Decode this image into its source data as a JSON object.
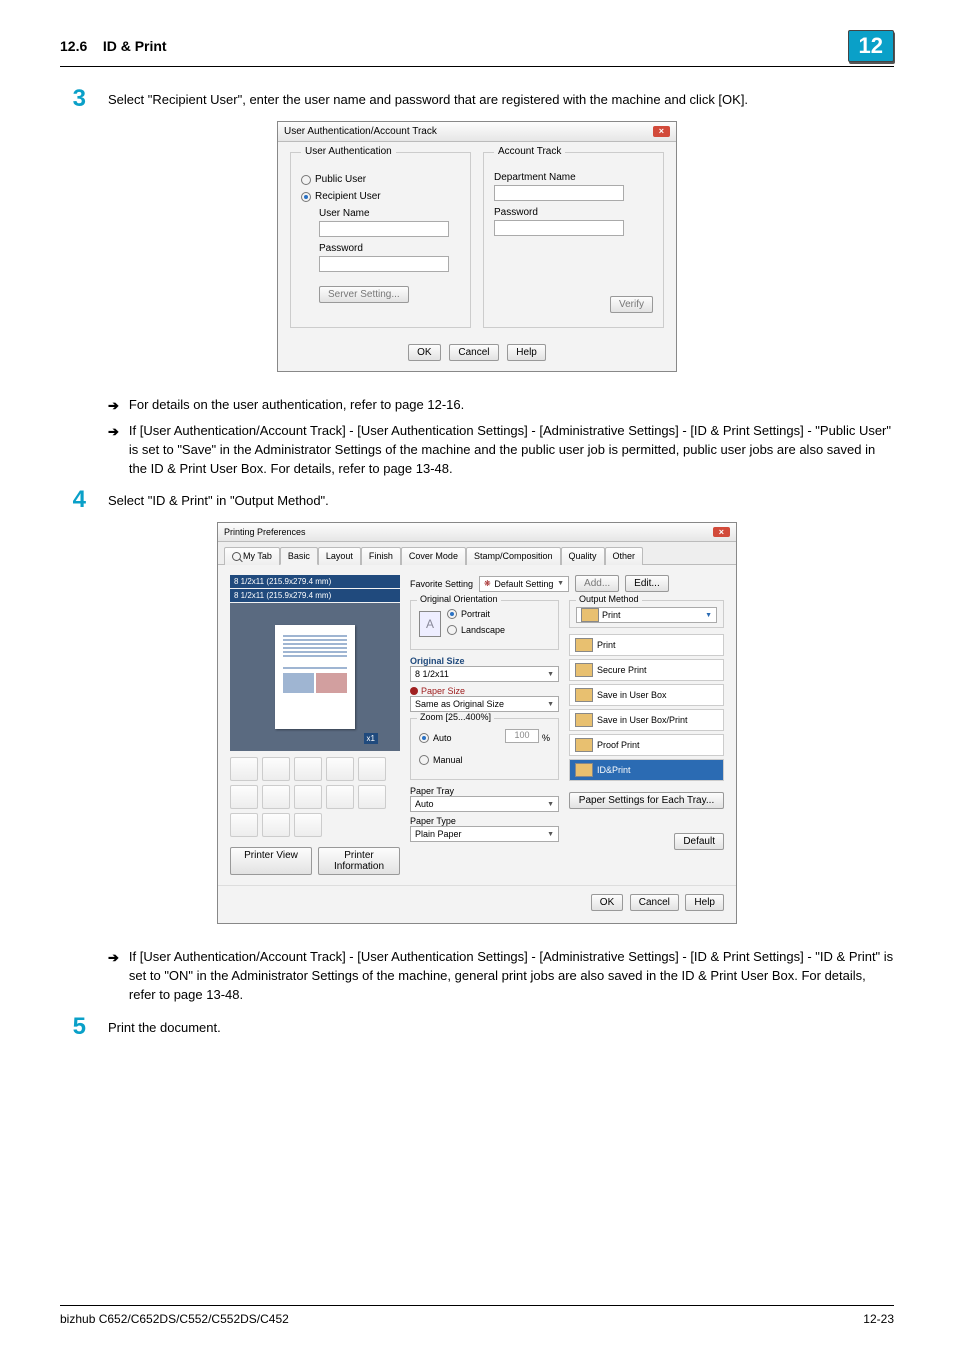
{
  "header": {
    "section_number": "12.6",
    "section_title": "ID & Print",
    "chapter_badge": "12"
  },
  "steps": {
    "s3": {
      "num": "3",
      "text": "Select \"Recipient User\", enter the user name and password that are registered with the machine and click [OK].",
      "bullet1": "For details on the user authentication, refer to page 12-16.",
      "bullet2": "If [User Authentication/Account Track] - [User Authentication Settings] - [Administrative Settings] - [ID & Print Settings] - \"Public User\" is set to \"Save\" in the Administrator Settings of the machine and the public user job is permitted, public user jobs are also saved in the ID & Print User Box. For details, refer to page 13-48."
    },
    "s4": {
      "num": "4",
      "text": "Select \"ID & Print\" in \"Output Method\".",
      "bullet1": "If [User Authentication/Account Track] - [User Authentication Settings] - [Administrative Settings] - [ID & Print Settings] - \"ID & Print\" is set to \"ON\" in the Administrator Settings of the machine, general print jobs are also saved in the ID & Print User Box. For details, refer to page 13-48."
    },
    "s5": {
      "num": "5",
      "text": "Print the document."
    }
  },
  "auth_dialog": {
    "title": "User Authentication/Account Track",
    "close": "×",
    "left_group": "User Authentication",
    "radio_public": "Public User",
    "radio_recipient": "Recipient User",
    "lbl_user": "User Name",
    "lbl_pass": "Password",
    "server_btn": "Server Setting...",
    "right_group": "Account Track",
    "lbl_dept": "Department Name",
    "lbl_pass2": "Password",
    "verify_btn": "Verify",
    "ok": "OK",
    "cancel": "Cancel",
    "help": "Help"
  },
  "prefs_dialog": {
    "title": "Printing Preferences",
    "close": "×",
    "tabs": {
      "mytab": "My Tab",
      "basic": "Basic",
      "layout": "Layout",
      "finish": "Finish",
      "cover": "Cover Mode",
      "stamp": "Stamp/Composition",
      "quality": "Quality",
      "other": "Other"
    },
    "paper_size_1": "8 1/2x11 (215.9x279.4 mm)",
    "paper_size_2": "8 1/2x11 (215.9x279.4 mm)",
    "printer_view": "Printer View",
    "printer_info": "Printer Information",
    "fav_label": "Favorite Setting",
    "fav_value": "Default Setting",
    "fav_add": "Add...",
    "fav_edit": "Edit...",
    "orientation_grp": "Original Orientation",
    "portrait": "Portrait",
    "landscape": "Landscape",
    "original_size_lbl": "Original Size",
    "original_size_val": "8 1/2x11",
    "paper_size_lbl": "Paper Size",
    "paper_size_val": "Same as Original Size",
    "zoom_grp": "Zoom [25...400%]",
    "zoom_auto": "Auto",
    "zoom_manual": "Manual",
    "zoom_value": "100",
    "zoom_pct": "%",
    "paper_tray_lbl": "Paper Tray",
    "paper_tray_val": "Auto",
    "paper_type_lbl": "Paper Type",
    "paper_type_val": "Plain Paper",
    "output_method_grp": "Output Method",
    "output_print_btn": "Print",
    "out_items": {
      "print": "Print",
      "secure": "Secure Print",
      "savebox": "Save in User Box",
      "saveprint": "Save in User Box/Print",
      "proof": "Proof Print",
      "idprint": "ID&Print"
    },
    "paper_settings_btn": "Paper Settings for Each Tray...",
    "default_btn": "Default",
    "ok": "OK",
    "cancel": "Cancel",
    "help": "Help"
  },
  "footer": {
    "model": "bizhub C652/C652DS/C552/C552DS/C452",
    "page": "12-23"
  }
}
